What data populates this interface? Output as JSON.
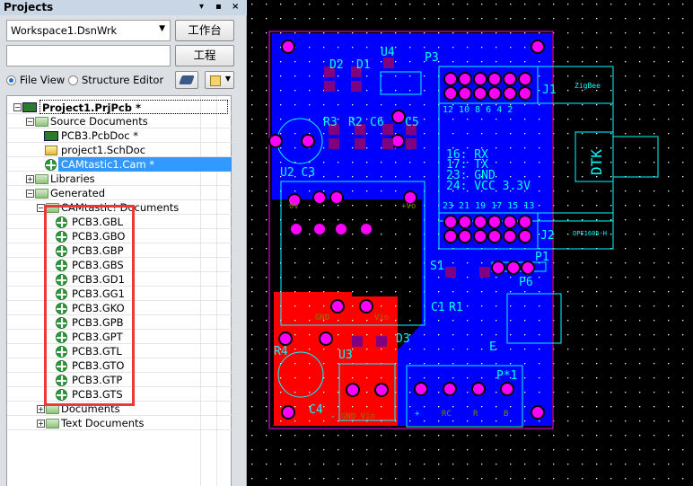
{
  "panel": {
    "title": "Projects",
    "title_buttons": [
      "▾",
      "▪",
      "×"
    ],
    "workspace": "Workspace1.DsnWrk",
    "workbench_btn": "工作台",
    "project_btn": "工程",
    "project_input": "",
    "file_view": "File View",
    "structure_editor": "Structure Editor",
    "file_view_selected": true
  },
  "tree": {
    "project": "Project1.PrjPcb *",
    "source": "Source Documents",
    "source_items": [
      "PCB3.PcbDoc *",
      "project1.SchDoc",
      "CAMtastic1.Cam *"
    ],
    "libraries": "Libraries",
    "generated": "Generated",
    "cam_docs": "CAMtastic! Documents",
    "cam_items": [
      "PCB3.GBL",
      "PCB3.GBO",
      "PCB3.GBP",
      "PCB3.GBS",
      "PCB3.GD1",
      "PCB3.GG1",
      "PCB3.GKO",
      "PCB3.GPB",
      "PCB3.GPT",
      "PCB3.GTL",
      "PCB3.GTO",
      "PCB3.GTP",
      "PCB3.GTS"
    ],
    "documents": "Documents",
    "text_documents": "Text Documents",
    "selected": "CAMtastic1.Cam *"
  },
  "pcb": {
    "labels": {
      "d2": "D2",
      "d1": "D1",
      "u4": "U4",
      "p3": "P3",
      "r3": "R3",
      "r2": "R2",
      "c6": "C6",
      "c5": "C5",
      "u2c3": "U2 C3",
      "j1": "J1",
      "zigbee": "ZigBee",
      "j1pins": "12 10 8 6 4 2",
      "pin16": "16: RX",
      "pin17": "17: TX",
      "pin23": "23: GND",
      "pin24": "24: VCC 3.3V",
      "j2pins": "23 21 19 17 15 13",
      "j2": "J2",
      "opf": "OPF1605-H",
      "dtk": "DTK",
      "ov": "0V",
      "vo": "+Vo",
      "gnd": "GND",
      "vin": "Vin",
      "s1": "S1",
      "p1": "P1",
      "p6": "P6",
      "c1": "C1",
      "r1": "R1",
      "d3": "D3",
      "r4": "R4",
      "u3": "U3",
      "c4": "C4",
      "e": "E",
      "px1": "P*1",
      "plus": "+",
      "rc": "RC",
      "r": "R",
      "b": "B",
      "minus": "-",
      "gndvin": "GND Vin"
    },
    "colors": {
      "bottom_copper": "#0000ff",
      "top_copper": "#ff0000",
      "pads": "#ff00ff",
      "silk": "#00ffff",
      "outline": "#ff00ff",
      "smd": "#800080",
      "grid": "#ffffff",
      "background": "#000000",
      "selection": "#3399ff",
      "highlight": "#e83a3a"
    }
  }
}
